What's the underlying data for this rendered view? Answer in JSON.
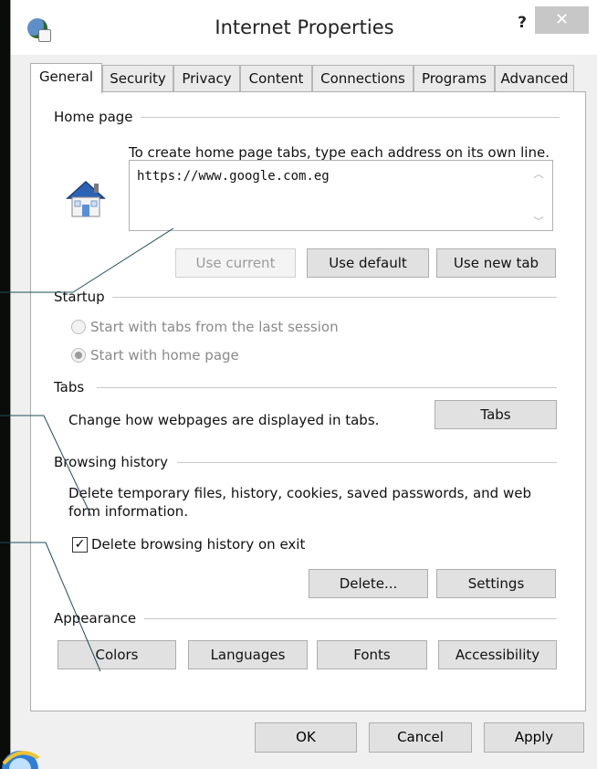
{
  "window": {
    "title": "Internet Properties",
    "help_label": "?",
    "close_label": "✕"
  },
  "tabs": [
    {
      "label": "General",
      "active": true
    },
    {
      "label": "Security"
    },
    {
      "label": "Privacy"
    },
    {
      "label": "Content"
    },
    {
      "label": "Connections"
    },
    {
      "label": "Programs"
    },
    {
      "label": "Advanced"
    }
  ],
  "home_page": {
    "group_label": "Home page",
    "instruction": "To create home page tabs, type each address on its own line.",
    "url_value": "https://www.google.com.eg",
    "use_current_label": "Use current",
    "use_default_label": "Use default",
    "use_new_tab_label": "Use new tab"
  },
  "startup": {
    "group_label": "Startup",
    "option_last_session": "Start with tabs from the last session",
    "option_home_page": "Start with home page",
    "selected": "home_page"
  },
  "tabs_section": {
    "group_label": "Tabs",
    "description": "Change how webpages are displayed in tabs.",
    "button_label": "Tabs"
  },
  "browsing_history": {
    "group_label": "Browsing history",
    "description_line1": "Delete temporary files, history, cookies, saved passwords, and web",
    "description_line2": "form information.",
    "delete_on_exit_label": "Delete browsing history on exit",
    "delete_on_exit_checked": true,
    "delete_button_label": "Delete...",
    "settings_button_label": "Settings"
  },
  "appearance": {
    "group_label": "Appearance",
    "colors_label": "Colors",
    "languages_label": "Languages",
    "fonts_label": "Fonts",
    "accessibility_label": "Accessibility"
  },
  "footer": {
    "ok_label": "OK",
    "cancel_label": "Cancel",
    "apply_label": "Apply"
  },
  "colors": {
    "title_bar": "#ffffff",
    "close_button": "#c7c7c7",
    "dialog_bg": "#f0f0f0",
    "annotation_line": "#1f4e5a"
  }
}
